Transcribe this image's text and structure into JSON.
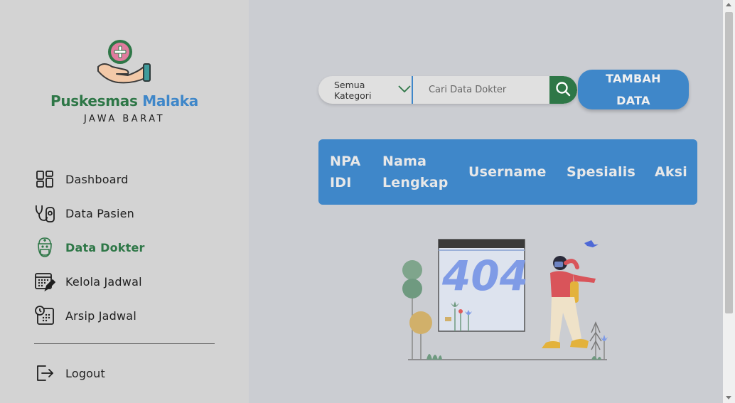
{
  "brand": {
    "name_part1": "Puskesmas",
    "name_part2": "Malaka",
    "subtitle": "JAWA BARAT"
  },
  "sidebar": {
    "items": [
      {
        "label": "Dashboard",
        "icon": "dashboard-icon"
      },
      {
        "label": "Data Pasien",
        "icon": "stethoscope-icon"
      },
      {
        "label": "Data Dokter",
        "icon": "doctor-icon",
        "active": true
      },
      {
        "label": "Kelola Jadwal",
        "icon": "calendar-edit-icon"
      },
      {
        "label": "Arsip Jadwal",
        "icon": "calendar-clock-icon"
      }
    ],
    "logout_label": "Logout"
  },
  "toolbar": {
    "category_value": "Semua Kategori",
    "search_placeholder": "Cari Data Dokter",
    "add_label": "TAMBAH DATA"
  },
  "table": {
    "headers": [
      "NPA IDI",
      "Nama Lengkap",
      "Username",
      "Spesialis",
      "Aksi"
    ]
  },
  "illustration": {
    "code": "404"
  },
  "colors": {
    "brand_green": "#2e7747",
    "brand_blue": "#3f87c9",
    "sidebar_bg": "#d3d3d3",
    "main_bg": "#cbcdd2"
  }
}
